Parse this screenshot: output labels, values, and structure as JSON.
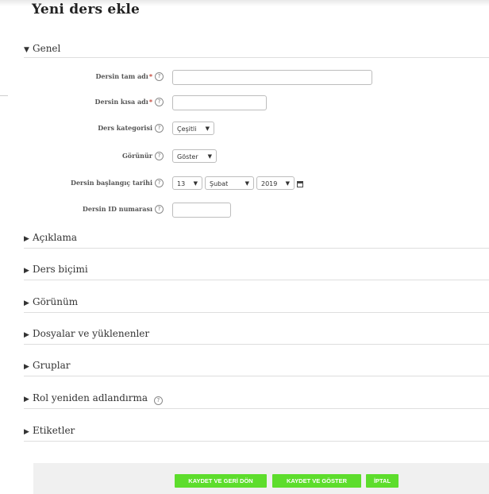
{
  "page": {
    "title": "Yeni ders ekle"
  },
  "sections": {
    "genel": "Genel",
    "aciklama": "Açıklama",
    "ders_bicimi": "Ders biçimi",
    "gorunum": "Görünüm",
    "dosyalar": "Dosyalar ve yüklenenler",
    "gruplar": "Gruplar",
    "rol": "Rol yeniden adlandırma",
    "etiketler": "Etiketler"
  },
  "form": {
    "fullname_label": "Dersin tam adı",
    "shortname_label": "Dersin kısa adı",
    "category_label": "Ders kategorisi",
    "category_value": "Çeşitli",
    "visible_label": "Görünür",
    "visible_value": "Göster",
    "startdate_label": "Dersin başlangıç tarihi",
    "start_day": "13",
    "start_month": "Şubat",
    "start_year": "2019",
    "idnumber_label": "Dersin ID numarası",
    "required_mark": "*",
    "help_glyph": "?"
  },
  "buttons": {
    "save_return": "KAYDET VE GERİ DÖN",
    "save_display": "KAYDET VE GÖSTER",
    "cancel": "İPTAL"
  },
  "colors": {
    "button_bg": "#5ddd2c",
    "required": "#c0392b"
  }
}
